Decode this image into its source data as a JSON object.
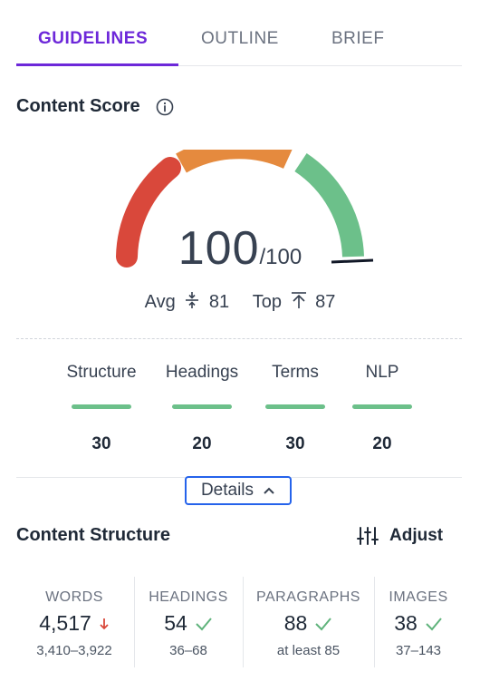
{
  "tabs": [
    {
      "label": "GUIDELINES",
      "active": true
    },
    {
      "label": "OUTLINE",
      "active": false
    },
    {
      "label": "BRIEF",
      "active": false
    }
  ],
  "content_score": {
    "title": "Content Score",
    "score": "100",
    "max": "/100",
    "score_value": 100,
    "avg_label": "Avg",
    "avg_value": "81",
    "top_label": "Top",
    "top_value": "87",
    "gauge_colors": {
      "low": "#d9483b",
      "mid": "#e58a3e",
      "high": "#6cc08a"
    }
  },
  "categories": [
    {
      "label": "Structure",
      "value": "30"
    },
    {
      "label": "Headings",
      "value": "20"
    },
    {
      "label": "Terms",
      "value": "30"
    },
    {
      "label": "NLP",
      "value": "20"
    }
  ],
  "details_label": "Details",
  "content_structure": {
    "title": "Content Structure",
    "adjust_label": "Adjust",
    "stats": [
      {
        "label": "WORDS",
        "value": "4,517",
        "status": "arrow-down-icon",
        "range": "3,410–3,922"
      },
      {
        "label": "HEADINGS",
        "value": "54",
        "status": "check-icon",
        "range": "36–68"
      },
      {
        "label": "PARAGRAPHS",
        "value": "88",
        "status": "check-icon",
        "range": "at least 85"
      },
      {
        "label": "IMAGES",
        "value": "38",
        "status": "check-icon",
        "range": "37–143"
      }
    ]
  },
  "colors": {
    "accent": "#6d28d9",
    "good": "#6cc08a",
    "warn": "#e58a3e",
    "bad": "#d9483b",
    "focus": "#2563eb"
  }
}
